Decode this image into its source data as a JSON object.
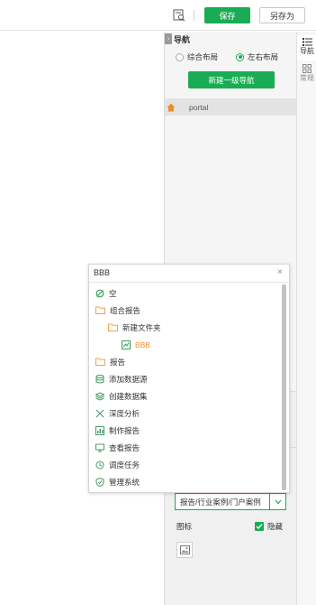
{
  "toolbar": {
    "save_label": "保存",
    "save_as_label": "另存为",
    "preview_icon": "preview-icon"
  },
  "nav_panel": {
    "title": "导航",
    "layout_options": [
      {
        "label": "综合布局",
        "checked": false
      },
      {
        "label": "左右布局",
        "checked": true
      }
    ],
    "new_nav_button": "新建一级导航",
    "nav_items": [
      {
        "label": "portal",
        "icon": "home-icon"
      }
    ]
  },
  "properties": {
    "path_value": "报告/行业案例/门户案例",
    "icon_label": "图标",
    "hide_label": "隐藏",
    "hide_checked": true
  },
  "side_tabs": [
    {
      "label": "导航",
      "icon": "list-icon"
    },
    {
      "label": "常规",
      "icon": "grid-icon"
    }
  ],
  "dropdown": {
    "search_value": "BBB",
    "items": [
      {
        "label": "空",
        "icon": "empty-icon",
        "level": 0
      },
      {
        "label": "组合报告",
        "icon": "folder-icon",
        "level": 0
      },
      {
        "label": "新建文件夹",
        "icon": "folder-icon",
        "level": 1
      },
      {
        "label": "BBB",
        "icon": "report-icon",
        "level": 2
      },
      {
        "label": "报告",
        "icon": "folder-icon",
        "level": 0
      },
      {
        "label": "添加数据源",
        "icon": "database-icon",
        "level": 0
      },
      {
        "label": "创建数据集",
        "icon": "dataset-icon",
        "level": 0
      },
      {
        "label": "深度分析",
        "icon": "analysis-icon",
        "level": 0
      },
      {
        "label": "制作报告",
        "icon": "chart-icon",
        "level": 0
      },
      {
        "label": "查看报告",
        "icon": "monitor-icon",
        "level": 0
      },
      {
        "label": "调度任务",
        "icon": "clock-icon",
        "level": 0
      },
      {
        "label": "管理系统",
        "icon": "shield-icon",
        "level": 0
      }
    ]
  },
  "colors": {
    "accent": "#1aac54",
    "folder": "#f0a050",
    "home": "#f08a30",
    "highlight_text": "#f0902a"
  }
}
